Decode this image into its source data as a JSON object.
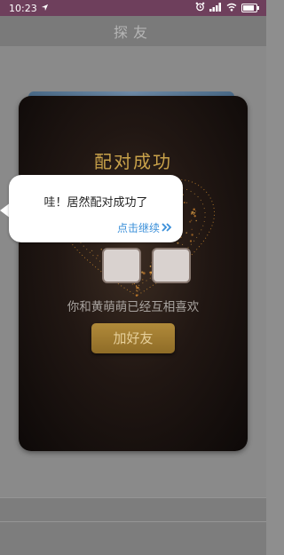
{
  "status_bar": {
    "time": "10:23",
    "location_icon": "location-arrow-icon",
    "alarm_icon": "alarm-icon",
    "signal_icon": "signal-bars-icon",
    "wifi_icon": "wifi-icon",
    "battery_icon": "battery-icon",
    "battery_level": 0.85
  },
  "header": {
    "title": "探友"
  },
  "modal": {
    "title": "配对成功",
    "subtitle": "你和黄萌萌已经互相喜欢",
    "add_friend_label": "加好友"
  },
  "bubble": {
    "message": "哇！居然配对成功了",
    "continue_label": "点击继续",
    "continue_icon": "double-chevron-right-icon"
  },
  "colors": {
    "status_bar": "#6e3f5c",
    "accent_gold": "#c9a24a",
    "link_blue": "#3a8fd9"
  }
}
